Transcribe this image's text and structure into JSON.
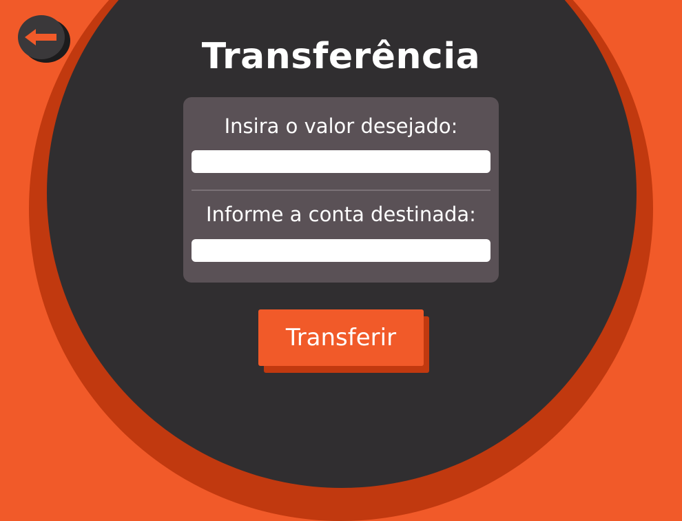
{
  "page": {
    "title": "Transferência"
  },
  "nav": {
    "back_icon": "arrow-left-icon"
  },
  "form": {
    "amount_label": "Insira o valor desejado:",
    "amount_value": "",
    "account_label": "Informe a conta destinada:",
    "account_value": ""
  },
  "actions": {
    "transfer_label": "Transferir"
  },
  "colors": {
    "background": "#f15a29",
    "background_shadow": "#c1390f",
    "panel": "#302e30",
    "card": "#5a5156",
    "accent": "#f15a29",
    "text": "#ffffff"
  }
}
